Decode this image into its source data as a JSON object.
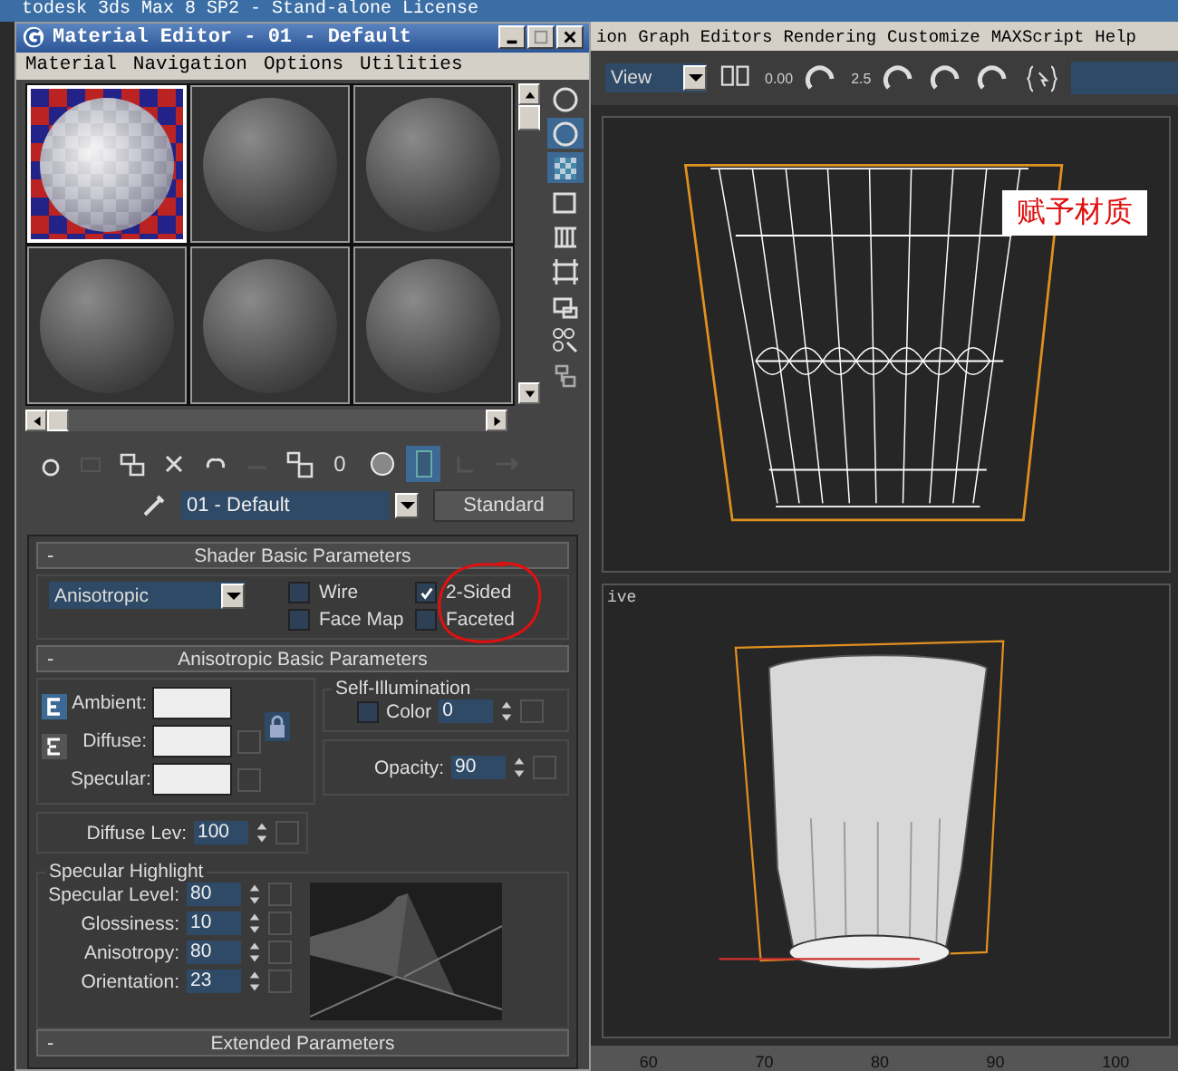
{
  "app": {
    "title": "todesk 3ds Max 8 SP2  -  Stand-alone License",
    "menu": [
      "ion",
      "Graph Editors",
      "Rendering",
      "Customize",
      "MAXScript",
      "Help"
    ],
    "view_dropdown": "View",
    "snap_value": "0.00",
    "angle_snap": "2.5"
  },
  "viewports": [
    {
      "kind": "wire",
      "note": "赋予材质"
    },
    {
      "kind": "shaded",
      "label": "ive"
    }
  ],
  "timeline": [
    "60",
    "70",
    "80",
    "90",
    "100"
  ],
  "editor": {
    "title": "Material Editor - 01 - Default",
    "menu": [
      "Material",
      "Navigation",
      "Options",
      "Utilities"
    ],
    "samples": [
      {
        "kind": "checker",
        "selected": true
      },
      {
        "kind": "sphere",
        "selected": false
      },
      {
        "kind": "sphere",
        "selected": false
      },
      {
        "kind": "sphere",
        "selected": false
      },
      {
        "kind": "sphere",
        "selected": false
      },
      {
        "kind": "sphere",
        "selected": false
      }
    ],
    "side_tools": [
      {
        "kind": "sphere",
        "on": false
      },
      {
        "kind": "light",
        "on": true
      },
      {
        "kind": "checker",
        "on": true
      },
      {
        "kind": "box",
        "on": false
      },
      {
        "kind": "film",
        "on": false
      },
      {
        "kind": "frame",
        "on": false
      },
      {
        "kind": "options",
        "on": false
      },
      {
        "kind": "select",
        "on": false
      },
      {
        "kind": "nav",
        "on": false
      }
    ],
    "bottom_tools": [
      {
        "kind": "get",
        "on": false
      },
      {
        "kind": "put",
        "on": false
      },
      {
        "kind": "assign",
        "on": false
      },
      {
        "kind": "delete",
        "on": false
      },
      {
        "kind": "copy",
        "on": false
      },
      {
        "kind": "unique",
        "on": false
      },
      {
        "kind": "library",
        "on": false
      },
      {
        "kind": "id",
        "on": false,
        "text": "0"
      },
      {
        "kind": "globe",
        "on": false
      },
      {
        "kind": "show",
        "on": true
      },
      {
        "kind": "parent",
        "on": false
      },
      {
        "kind": "sibling",
        "on": false
      }
    ],
    "material_name": "01 - Default",
    "material_type": "Standard",
    "shader": {
      "collapse": "-",
      "title": "Shader Basic Parameters",
      "type": "Anisotropic",
      "options": [
        {
          "label": "Wire",
          "checked": false
        },
        {
          "label": "2-Sided",
          "checked": true
        },
        {
          "label": "Face Map",
          "checked": false
        },
        {
          "label": "Faceted",
          "checked": false
        }
      ]
    },
    "basic": {
      "collapse": "-",
      "title": "Anisotropic Basic Parameters",
      "colors": [
        {
          "label": "Ambient:",
          "map": false
        },
        {
          "label": "Diffuse:",
          "map": true
        },
        {
          "label": "Specular:",
          "map": true
        }
      ],
      "self_illum": {
        "title": "Self-Illumination",
        "label": "Color",
        "checked": false,
        "value": "0"
      },
      "opacity": {
        "label": "Opacity:",
        "value": "90"
      },
      "diffuse_level": {
        "label": "Diffuse Lev:",
        "value": "100"
      },
      "highlight": {
        "title": "Specular Highlight",
        "params": [
          {
            "label": "Specular Level:",
            "value": "80"
          },
          {
            "label": "Glossiness:",
            "value": "10"
          },
          {
            "label": "Anisotropy:",
            "value": "80"
          },
          {
            "label": "Orientation:",
            "value": "23"
          }
        ]
      }
    },
    "extended": {
      "collapse": "-",
      "title": "Extended Parameters"
    }
  }
}
